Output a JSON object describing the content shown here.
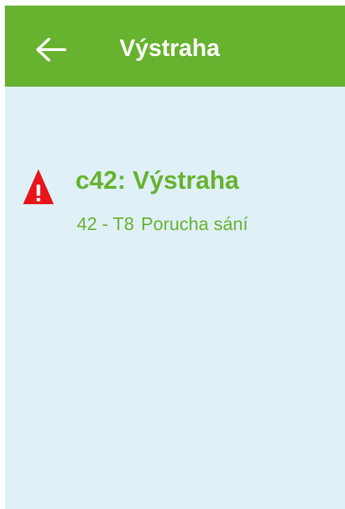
{
  "header": {
    "back_icon": "arrow-left-icon",
    "title": "Výstraha"
  },
  "alert": {
    "icon": "warning-icon",
    "title": "c42: Výstraha",
    "code": "42 - T8",
    "message": "Porucha sání"
  },
  "colors": {
    "header_bg": "#67b22f",
    "content_bg": "#dff0f7",
    "accent_text": "#67b22f",
    "warning": "#e8141b"
  }
}
